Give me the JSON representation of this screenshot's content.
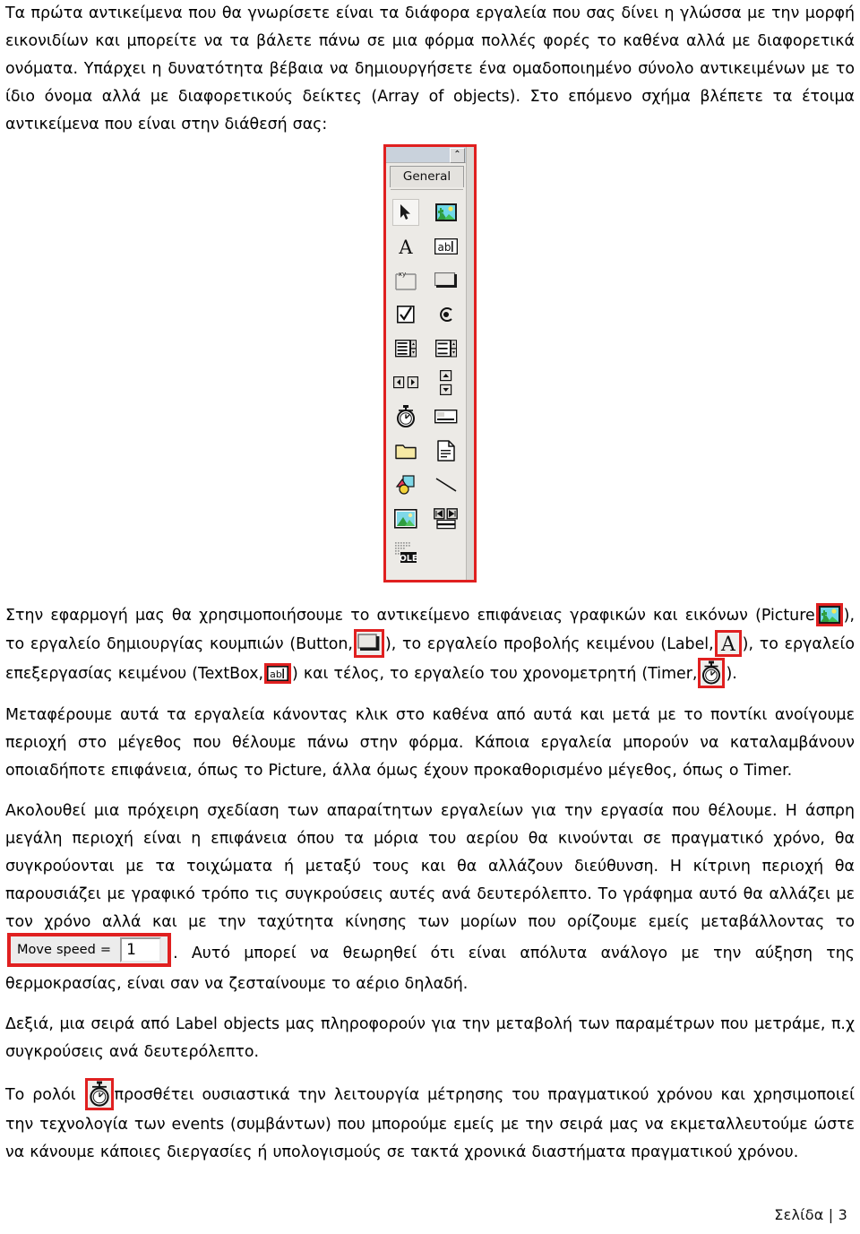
{
  "document": {
    "language": "el",
    "page_label": "Σελίδα | 3",
    "accent_color": "#e02020"
  },
  "paragraphs": {
    "intro": "Τα πρώτα αντικείμενα που θα γνωρίσετε είναι τα διάφορα εργαλεία που σας δίνει η γλώσσα με την μορφή εικονιδίων και μπορείτε να τα βάλετε πάνω σε μια φόρμα πολλές φορές το καθένα αλλά με διαφορετικά ονόματα. Υπάρχει η δυνατότητα βέβαια να δημιουργήσετε ένα ομαδοποιημένο σύνολο αντικειμένων με το ίδιο όνομα αλλά με διαφορετικούς δείκτες (Array of objects). Στο επόμενο σχήμα βλέπετε τα έτοιμα αντικείμενα που είναι στην διάθεσή σας:",
    "tools_intro_a": "Στην εφαρμογή μας θα χρησιμοποιήσουμε το αντικείμενο επιφάνειας γραφικών και εικόνων (Picture",
    "tools_intro_b": "), το εργαλείο δημιουργίας κουμπιών (Button,",
    "tools_intro_c": "), το εργαλείο προβολής κειμένου (Label,",
    "tools_intro_d": "), το εργαλείο επεξεργασίας κειμένου (TextBox,",
    "tools_intro_e": ") και τέλος, το εργαλείο του χρονομετρητή (Timer,",
    "tools_intro_f": ").",
    "transfer": "Μεταφέρουμε αυτά τα εργαλεία κάνοντας κλικ στο καθένα από αυτά και μετά με το ποντίκι ανοίγουμε περιοχή στο μέγεθος που θέλουμε πάνω στην φόρμα. Κάποια εργαλεία μπορούν να καταλαμβάνουν οποιαδήποτε επιφάνεια, όπως το Picture, άλλα όμως έχουν προκαθορισμένο μέγεθος, όπως ο Timer.",
    "sketch_a": "Ακολουθεί μια πρόχειρη σχεδίαση των απαραίτητων εργαλείων για την εργασία που θέλουμε. Η άσπρη μεγάλη περιοχή είναι η επιφάνεια όπου τα μόρια του αερίου θα κινούνται σε πραγματικό χρόνο, θα συγκρούονται με τα τοιχώματα ή μεταξύ τους και θα αλλάζουν διεύθυνση. Η κίτρινη περιοχή θα παρουσιάζει με γραφικό τρόπο τις συγκρούσεις αυτές ανά δευτερόλεπτο. Το γράφημα αυτό θα αλλάζει με τον χρόνο αλλά και με την ταχύτητα κίνησης των μορίων που ορίζουμε εμείς μεταβάλλοντας το",
    "sketch_b": ". Αυτό μπορεί να θεωρηθεί ότι είναι απόλυτα ανάλογο με την αύξηση της θερμοκρασίας, είναι σαν να ζεσταίνουμε το αέριο δηλαδή.",
    "labels_info": "Δεξιά, μια σειρά από Label objects μας πληροφορούν για την μεταβολή των παραμέτρων που μετράμε, π.χ συγκρούσεις ανά δευτερόλεπτο.",
    "clock_a": "Το ρολόι",
    "clock_b": "προσθέτει ουσιαστικά την λειτουργία μέτρησης του πραγματικού χρόνου και χρησιμοποιεί την τεχνολογία των events (συμβάντων) που μπορούμε εμείς με την σειρά μας να εκμεταλλευτούμε ώστε να κάνουμε κάποιες διεργασίες ή υπολογισμούς σε τακτά χρονικά διαστήματα πραγματικού χρόνου."
  },
  "toolbox": {
    "title_bar_button": "⌃",
    "tab_label": "General",
    "tools": [
      {
        "name": "pointer",
        "label": "Pointer"
      },
      {
        "name": "picture",
        "label": "Picture"
      },
      {
        "name": "label",
        "label": "Label"
      },
      {
        "name": "textbox",
        "label": "TextBox"
      },
      {
        "name": "frame",
        "label": "Frame"
      },
      {
        "name": "button",
        "label": "Button"
      },
      {
        "name": "checkbox",
        "label": "CheckBox"
      },
      {
        "name": "option-button",
        "label": "OptionButton"
      },
      {
        "name": "combobox",
        "label": "ComboBox"
      },
      {
        "name": "listbox",
        "label": "ListBox"
      },
      {
        "name": "hscrollbar",
        "label": "HScrollBar"
      },
      {
        "name": "vscrollbar",
        "label": "VScrollBar"
      },
      {
        "name": "timer",
        "label": "Timer"
      },
      {
        "name": "drive-listbox",
        "label": "DriveListBox"
      },
      {
        "name": "dir-listbox",
        "label": "DirListBox"
      },
      {
        "name": "file-listbox",
        "label": "FileListBox"
      },
      {
        "name": "shape",
        "label": "Shape"
      },
      {
        "name": "line",
        "label": "Line"
      },
      {
        "name": "image",
        "label": "Image"
      },
      {
        "name": "data",
        "label": "Data"
      },
      {
        "name": "ole",
        "label": "OLE"
      }
    ],
    "ole_caption": "OLE"
  },
  "speed_widget": {
    "label": "Move speed =",
    "value": "1"
  }
}
